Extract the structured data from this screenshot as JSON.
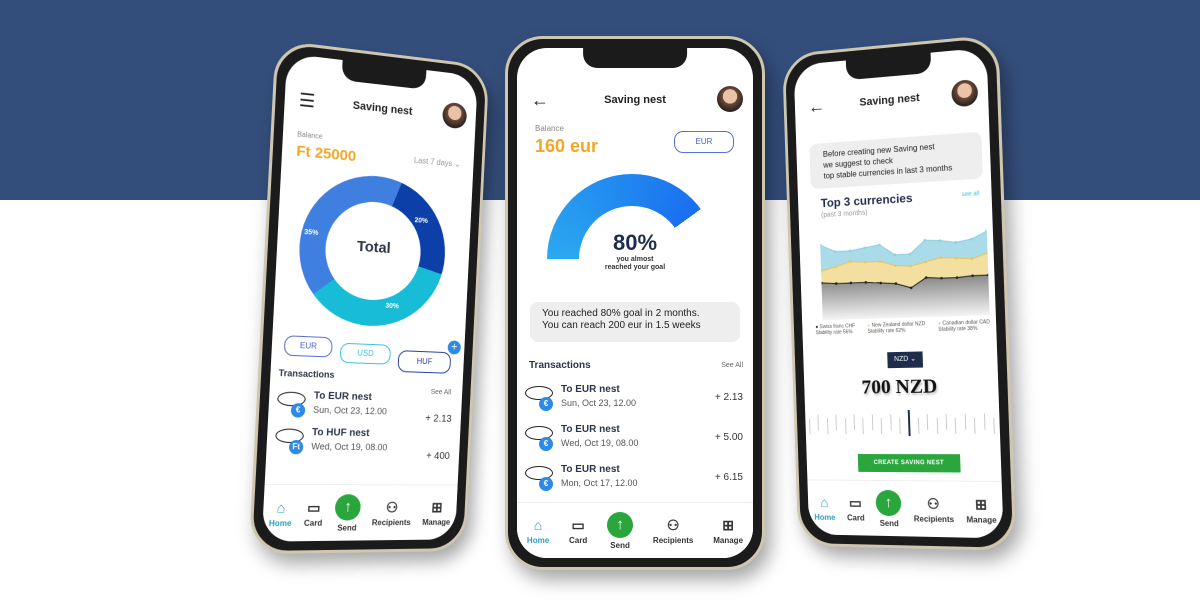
{
  "colors": {
    "background_top": "#344e7c",
    "accent_orange": "#f5a623",
    "send_green": "#2aa63d",
    "nav_active": "#2a9fc0"
  },
  "nav": [
    "Home",
    "Card",
    "Send",
    "Recipients",
    "Manage"
  ],
  "phone1": {
    "title": "Saving nest",
    "balance_label": "Balance",
    "balance": "Ft 25000",
    "period": "Last 7 days",
    "donut": {
      "center": "Total",
      "slices": [
        {
          "label": "35%",
          "value": 35,
          "color": "#3f7fe0"
        },
        {
          "label": "20%",
          "value": 20,
          "color": "#0d3fa8"
        },
        {
          "label": "30%",
          "value": 30,
          "color": "#18bcd6"
        }
      ]
    },
    "currencies": [
      "EUR",
      "USD",
      "HUF"
    ],
    "transactions_title": "Transactions",
    "see_all": "See All",
    "transactions": [
      {
        "name": "To EUR nest",
        "date": "Sun, Oct 23, 12.00",
        "amount": "+ 2.13",
        "badge": "€"
      },
      {
        "name": "To HUF nest",
        "date": "Wed, Oct 19, 08.00",
        "amount": "+ 400",
        "badge": "Ft"
      }
    ]
  },
  "phone2": {
    "title": "Saving nest",
    "balance_label": "Balance",
    "balance": "160 eur",
    "currency": "EUR",
    "progress": {
      "value": 80,
      "label": "80%",
      "sub1": "you almost",
      "sub2": "reached your goal"
    },
    "message1": "You reached 80% goal in 2 months.",
    "message2": "You can reach 200 eur in  1.5 weeks",
    "transactions_title": "Transactions",
    "see_all": "See All",
    "transactions": [
      {
        "name": "To EUR nest",
        "date": "Sun, Oct 23, 12.00",
        "amount": "+ 2.13",
        "badge": "€"
      },
      {
        "name": "To EUR nest",
        "date": "Wed, Oct 19, 08.00",
        "amount": "+ 5.00",
        "badge": "€"
      },
      {
        "name": "To EUR nest",
        "date": "Mon, Oct 17, 12.00",
        "amount": "+ 6.15",
        "badge": "€"
      }
    ]
  },
  "phone3": {
    "title": "Saving nest",
    "info1": "Before creating new Saving nest",
    "info2": "we suggest to check",
    "info3": "top stable currencies in last 3 months",
    "chart_title": "Top 3 currencies",
    "chart_sub": "(past 3 months)",
    "see_all": "see all",
    "currency_select": "NZD",
    "amount": "700 NZD",
    "create_button": "CREATE SAVING NEST"
  },
  "chart_data": {
    "type": "area",
    "title": "Top 3 currencies",
    "subtitle": "(past 3 months)",
    "x": [
      1,
      2,
      3,
      4,
      5,
      6,
      7,
      8,
      9,
      10,
      11,
      12
    ],
    "series": [
      {
        "name": "Canadian dollar CAD",
        "note": "Stability rate 38%",
        "color": "#a9dbe8",
        "values": [
          72,
          66,
          66,
          68,
          70,
          61,
          61,
          72,
          71,
          69,
          71,
          77
        ]
      },
      {
        "name": "New Zealand dollar NZD",
        "note": "Stability rate 62%",
        "color": "#f0d78c",
        "values": [
          50,
          53,
          57,
          56,
          56,
          52,
          51,
          54,
          57,
          56,
          55,
          59
        ]
      },
      {
        "name": "Swiss franc CHF",
        "note": "Stability rate 56%",
        "color": "#222222",
        "values": [
          40,
          39,
          39,
          39,
          38,
          37,
          33,
          41,
          40,
          40,
          41,
          41
        ]
      }
    ],
    "ylim": [
      0,
      100
    ],
    "legend": "bottom"
  }
}
